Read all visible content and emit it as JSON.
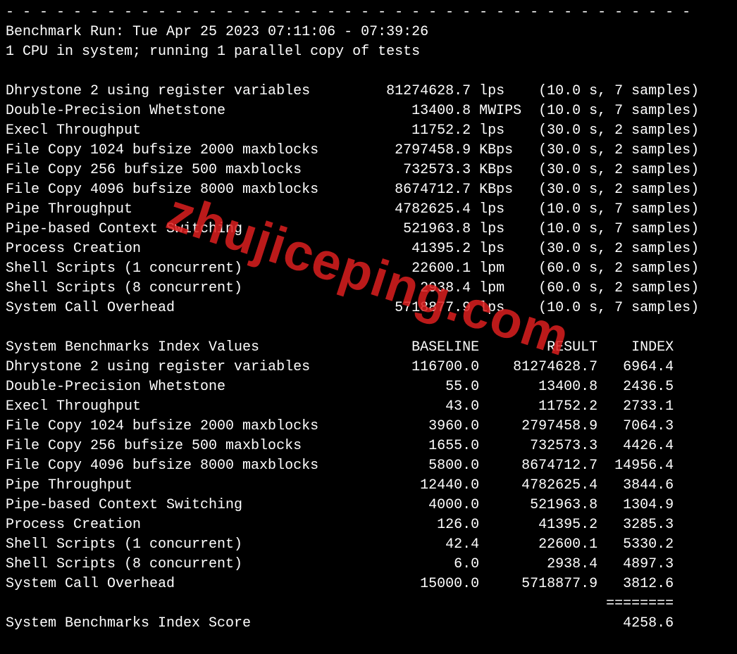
{
  "divider": "- - - - - - - - - - - - - - - - - - - - - - - - - - - - - - - - - - - - - - - - -",
  "header": {
    "run_line": "Benchmark Run: Tue Apr 25 2023 07:11:06 - 07:39:26",
    "cpu_line": "1 CPU in system; running 1 parallel copy of tests"
  },
  "results": [
    {
      "name": "Dhrystone 2 using register variables",
      "value": "81274628.7",
      "unit": "lps",
      "timing": "(10.0 s, 7 samples)"
    },
    {
      "name": "Double-Precision Whetstone",
      "value": "13400.8",
      "unit": "MWIPS",
      "timing": "(10.0 s, 7 samples)"
    },
    {
      "name": "Execl Throughput",
      "value": "11752.2",
      "unit": "lps",
      "timing": "(30.0 s, 2 samples)"
    },
    {
      "name": "File Copy 1024 bufsize 2000 maxblocks",
      "value": "2797458.9",
      "unit": "KBps",
      "timing": "(30.0 s, 2 samples)"
    },
    {
      "name": "File Copy 256 bufsize 500 maxblocks",
      "value": "732573.3",
      "unit": "KBps",
      "timing": "(30.0 s, 2 samples)"
    },
    {
      "name": "File Copy 4096 bufsize 8000 maxblocks",
      "value": "8674712.7",
      "unit": "KBps",
      "timing": "(30.0 s, 2 samples)"
    },
    {
      "name": "Pipe Throughput",
      "value": "4782625.4",
      "unit": "lps",
      "timing": "(10.0 s, 7 samples)"
    },
    {
      "name": "Pipe-based Context Switching",
      "value": "521963.8",
      "unit": "lps",
      "timing": "(10.0 s, 7 samples)"
    },
    {
      "name": "Process Creation",
      "value": "41395.2",
      "unit": "lps",
      "timing": "(30.0 s, 2 samples)"
    },
    {
      "name": "Shell Scripts (1 concurrent)",
      "value": "22600.1",
      "unit": "lpm",
      "timing": "(60.0 s, 2 samples)"
    },
    {
      "name": "Shell Scripts (8 concurrent)",
      "value": "2938.4",
      "unit": "lpm",
      "timing": "(60.0 s, 2 samples)"
    },
    {
      "name": "System Call Overhead",
      "value": "5718877.9",
      "unit": "lps",
      "timing": "(10.0 s, 7 samples)"
    }
  ],
  "index_header": {
    "title": "System Benchmarks Index Values",
    "col1": "BASELINE",
    "col2": "RESULT",
    "col3": "INDEX"
  },
  "index_rows": [
    {
      "name": "Dhrystone 2 using register variables",
      "baseline": "116700.0",
      "result": "81274628.7",
      "index": "6964.4"
    },
    {
      "name": "Double-Precision Whetstone",
      "baseline": "55.0",
      "result": "13400.8",
      "index": "2436.5"
    },
    {
      "name": "Execl Throughput",
      "baseline": "43.0",
      "result": "11752.2",
      "index": "2733.1"
    },
    {
      "name": "File Copy 1024 bufsize 2000 maxblocks",
      "baseline": "3960.0",
      "result": "2797458.9",
      "index": "7064.3"
    },
    {
      "name": "File Copy 256 bufsize 500 maxblocks",
      "baseline": "1655.0",
      "result": "732573.3",
      "index": "4426.4"
    },
    {
      "name": "File Copy 4096 bufsize 8000 maxblocks",
      "baseline": "5800.0",
      "result": "8674712.7",
      "index": "14956.4"
    },
    {
      "name": "Pipe Throughput",
      "baseline": "12440.0",
      "result": "4782625.4",
      "index": "3844.6"
    },
    {
      "name": "Pipe-based Context Switching",
      "baseline": "4000.0",
      "result": "521963.8",
      "index": "1304.9"
    },
    {
      "name": "Process Creation",
      "baseline": "126.0",
      "result": "41395.2",
      "index": "3285.3"
    },
    {
      "name": "Shell Scripts (1 concurrent)",
      "baseline": "42.4",
      "result": "22600.1",
      "index": "5330.2"
    },
    {
      "name": "Shell Scripts (8 concurrent)",
      "baseline": "6.0",
      "result": "2938.4",
      "index": "4897.3"
    },
    {
      "name": "System Call Overhead",
      "baseline": "15000.0",
      "result": "5718877.9",
      "index": "3812.6"
    }
  ],
  "score": {
    "label": "System Benchmarks Index Score",
    "value": "4258.6",
    "rule": "========"
  },
  "watermark": "zhujiceping.com"
}
